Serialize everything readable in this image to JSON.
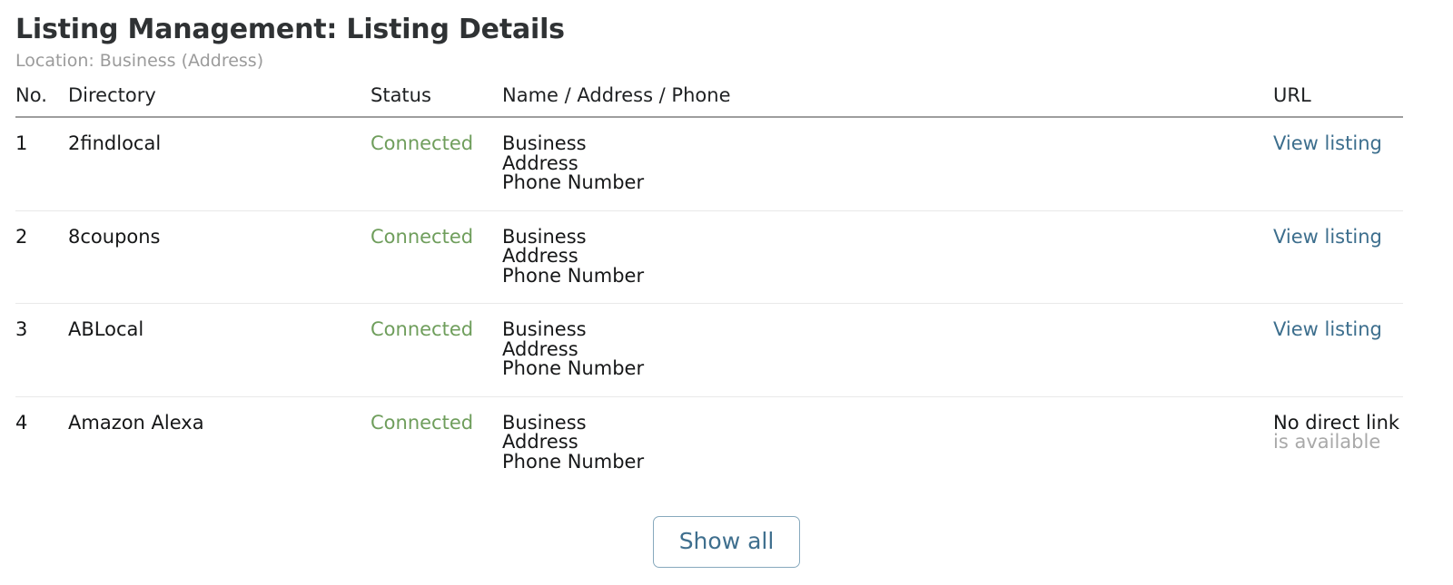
{
  "header": {
    "title": "Listing Management: Listing Details",
    "subtitle": "Location: Business (Address)"
  },
  "table": {
    "columns": {
      "no": "No.",
      "directory": "Directory",
      "status": "Status",
      "name_address_phone": "Name / Address / Phone",
      "url": "URL"
    },
    "rows": [
      {
        "no": "1",
        "directory": "2findlocal",
        "status": "Connected",
        "nap": {
          "name": "Business",
          "address": "Address",
          "phone": "Phone Number"
        },
        "url_label": "View listing",
        "url_type": "link"
      },
      {
        "no": "2",
        "directory": "8coupons",
        "status": "Connected",
        "nap": {
          "name": "Business",
          "address": "Address",
          "phone": "Phone Number"
        },
        "url_label": "View listing",
        "url_type": "link"
      },
      {
        "no": "3",
        "directory": "ABLocal",
        "status": "Connected",
        "nap": {
          "name": "Business",
          "address": "Address",
          "phone": "Phone Number"
        },
        "url_label": "View listing",
        "url_type": "link"
      },
      {
        "no": "4",
        "directory": "Amazon Alexa",
        "status": "Connected",
        "nap": {
          "name": "Business",
          "address": "Address",
          "phone": "Phone Number"
        },
        "url_label": "No direct link",
        "url_label_second": "is available",
        "url_type": "text"
      }
    ]
  },
  "footer": {
    "show_all_label": "Show all"
  },
  "colors": {
    "status_connected": "#6f9e5c",
    "link": "#3c6e8d",
    "button_border": "#87a9bd",
    "button_text": "#3f6f8e",
    "title": "#2f3234",
    "subtitle": "#9b9b9b",
    "header_rule": "#9d9d9d",
    "row_rule": "#e9e9e9"
  }
}
